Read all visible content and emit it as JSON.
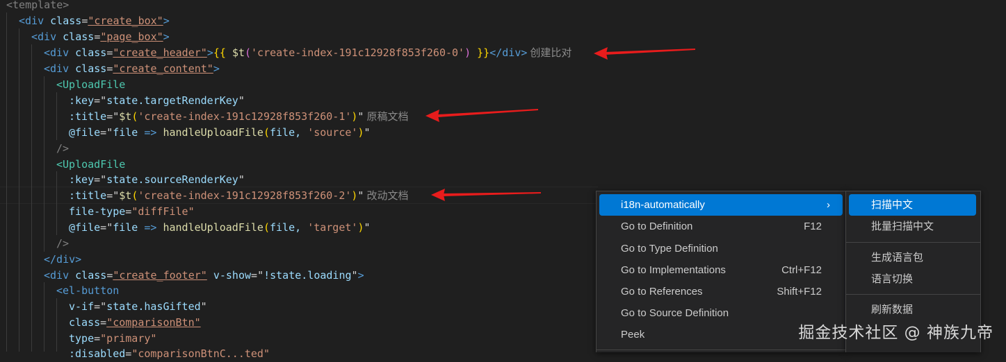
{
  "code": {
    "l1_tag": "<template>",
    "l2_open": "<div ",
    "l2_attr": "class",
    "l2_eq": "=",
    "l2_val": "\"create_box\"",
    "l2_close": ">",
    "l3_open": "<div ",
    "l3_attr": "class",
    "l3_eq": "=",
    "l3_val": "\"page_box\"",
    "l3_close": ">",
    "l4_open": "<div ",
    "l4_attr": "class",
    "l4_eq": "=",
    "l4_val": "\"create_header\"",
    "l4_close": ">",
    "l4_br_open": "{{ ",
    "l4_fn": "$t",
    "l4_paren_open": "(",
    "l4_str": "'create-index-191c12928f853f260-0'",
    "l4_paren_close": ")",
    "l4_br_close": " }}",
    "l4_end": "</div>",
    "l4_hint": "创建比对",
    "l5_open": "<div ",
    "l5_attr": "class",
    "l5_eq": "=",
    "l5_val": "\"create_content\"",
    "l5_close": ">",
    "l6_tag": "<UploadFile",
    "l7_attr": ":key",
    "l7_eq": "=",
    "l7_q1": "\"",
    "l7_val": "state.targetRenderKey",
    "l7_q2": "\"",
    "l8_attr": ":title",
    "l8_eq": "=",
    "l8_q1": "\"",
    "l8_fn": "$t",
    "l8_p1": "(",
    "l8_str": "'create-index-191c12928f853f260-1'",
    "l8_p2": ")",
    "l8_q2": "\"",
    "l8_hint": "原稿文档",
    "l9_attr": "@file",
    "l9_eq": "=",
    "l9_q1": "\"",
    "l9_v1": "file ",
    "l9_arrow": "=>",
    "l9_fn": " handleUploadFile",
    "l9_p1": "(",
    "l9_v2": "file, ",
    "l9_str": "'source'",
    "l9_p2": ")",
    "l9_q2": "\"",
    "l10": "/>",
    "l11_tag": "<UploadFile",
    "l12_attr": ":key",
    "l12_eq": "=",
    "l12_q1": "\"",
    "l12_val": "state.sourceRenderKey",
    "l12_q2": "\"",
    "l13_attr": ":title",
    "l13_eq": "=",
    "l13_q1": "\"",
    "l13_fn": "$t",
    "l13_p1": "(",
    "l13_str": "'create-index-191c12928f853f260-2'",
    "l13_p2": ")",
    "l13_q2": "\"",
    "l13_hint": "改动文档",
    "l14_attr": "file-type",
    "l14_eq": "=",
    "l14_val": "\"diffFile\"",
    "l15_attr": "@file",
    "l15_eq": "=",
    "l15_q1": "\"",
    "l15_v1": "file ",
    "l15_arrow": "=>",
    "l15_fn": " handleUploadFile",
    "l15_p1": "(",
    "l15_v2": "file, ",
    "l15_str": "'target'",
    "l15_p2": ")",
    "l15_q2": "\"",
    "l16": "/>",
    "l17": "</div>",
    "l18_open": "<div ",
    "l18_attr": "class",
    "l18_eq": "=",
    "l18_val": "\"create_footer\"",
    "l18_sp": " ",
    "l18_attr2": "v-show",
    "l18_eq2": "=",
    "l18_q1": "\"",
    "l18_val2": "!state.loading",
    "l18_q2": "\"",
    "l18_close": ">",
    "l19_tag": "<el-button",
    "l20_attr": "v-if",
    "l20_eq": "=",
    "l20_q1": "\"",
    "l20_val": "state.hasGifted",
    "l20_q2": "\"",
    "l21_attr": "class",
    "l21_eq": "=",
    "l21_val": "\"comparisonBtn\"",
    "l22_attr": "type",
    "l22_eq": "=",
    "l22_val": "\"primary\"",
    "l23_attr": ":disabled",
    "l23_eq": "=",
    "l23_val": "\"comparisonBtnC...ted\""
  },
  "context_menu": {
    "items": [
      {
        "label": "i18n-automatically",
        "shortcut": ""
      },
      {
        "label": "Go to Definition",
        "shortcut": "F12"
      },
      {
        "label": "Go to Type Definition",
        "shortcut": ""
      },
      {
        "label": "Go to Implementations",
        "shortcut": "Ctrl+F12"
      },
      {
        "label": "Go to References",
        "shortcut": "Shift+F12"
      },
      {
        "label": "Go to Source Definition",
        "shortcut": ""
      },
      {
        "label": "Peek",
        "shortcut": ""
      }
    ],
    "submenu_icon": "chevron-right-icon"
  },
  "submenu": {
    "items": [
      {
        "label": "扫描中文"
      },
      {
        "label": "批量扫描中文"
      },
      {
        "label": "生成语言包"
      },
      {
        "label": "语言切换"
      },
      {
        "label": "刷新数据"
      }
    ]
  },
  "watermark": "掘金技术社区 @ 神族九帝",
  "colors": {
    "accent": "#0078d4",
    "arrow": "#e81c1c",
    "background": "#1f1f1f"
  }
}
